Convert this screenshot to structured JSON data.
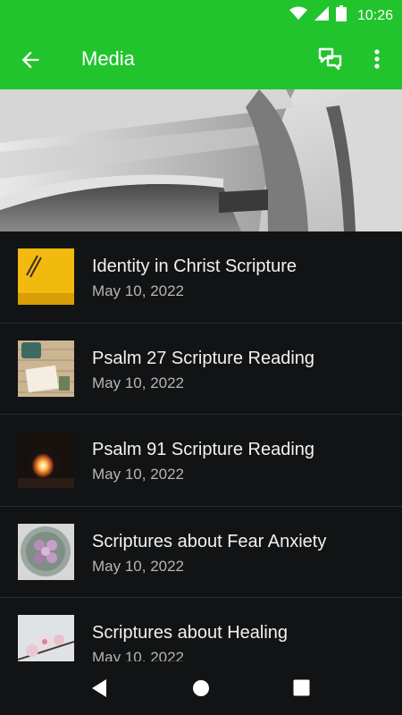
{
  "status_bar": {
    "time": "10:26"
  },
  "app_bar": {
    "title": "Media"
  },
  "colors": {
    "primary": "#22c42e",
    "background": "#121314"
  },
  "media_items": [
    {
      "title": "Identity in Christ Scripture",
      "date": "May 10, 2022"
    },
    {
      "title": "Psalm 27 Scripture Reading",
      "date": "May 10, 2022"
    },
    {
      "title": "Psalm 91 Scripture Reading",
      "date": "May 10, 2022"
    },
    {
      "title": "Scriptures about Fear Anxiety",
      "date": "May 10, 2022"
    },
    {
      "title": "Scriptures about Healing",
      "date": "May 10, 2022"
    }
  ],
  "icons": [
    "wifi-icon",
    "signal-icon",
    "battery-icon",
    "back-arrow-icon",
    "chat-icon",
    "more-vert-icon",
    "nav-back-icon",
    "nav-home-icon",
    "nav-recents-icon"
  ]
}
